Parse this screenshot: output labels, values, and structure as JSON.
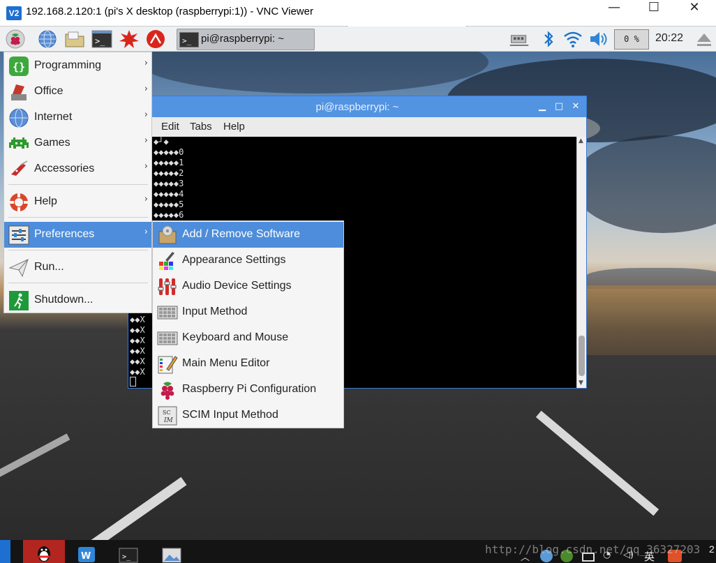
{
  "vnc_window": {
    "logo": "V2",
    "title": "192.168.2.120:1 (pi's X desktop (raspberrypi:1)) - VNC Viewer",
    "minimize": "—",
    "maximize": "☐",
    "close": "✕"
  },
  "panel": {
    "task_label": "pi@raspberrypi: ~",
    "cpu": "0 %",
    "clock": "20:22",
    "icons": [
      "raspberry-icon",
      "globe-icon",
      "folder-icon",
      "terminal-icon",
      "burst-icon",
      "wolfram-icon",
      "network-icon",
      "bluetooth-icon",
      "wifi-icon",
      "volume-icon",
      "eject-icon"
    ]
  },
  "terminal": {
    "title": "pi@raspberrypi: ~",
    "menu": [
      "Edit",
      "Tabs",
      "Help"
    ],
    "lines": [
      "◆┘◆",
      "◆◆◆◆◆0",
      "◆◆◆◆◆1",
      "◆◆◆◆◆2",
      "◆◆◆◆◆3",
      "◆◆◆◆◆4",
      "◆◆◆◆◆5",
      "◆◆◆◆◆6"
    ],
    "lower_lines": [
      "◆◆X",
      "◆◆X",
      "◆◆X",
      "◆◆X",
      "◆◆X",
      "◆◆X"
    ],
    "minimize": "▁",
    "maximize": "□",
    "close": "✕"
  },
  "main_menu": {
    "items": [
      {
        "label": "Programming",
        "arrow": "›"
      },
      {
        "label": "Office",
        "arrow": "›"
      },
      {
        "label": "Internet",
        "arrow": "›"
      },
      {
        "label": "Games",
        "arrow": "›"
      },
      {
        "label": "Accessories",
        "arrow": "›"
      },
      {
        "label": "Help",
        "arrow": "›"
      },
      {
        "label": "Preferences",
        "arrow": "›"
      },
      {
        "label": "Run..."
      },
      {
        "label": "Shutdown..."
      }
    ]
  },
  "prefs_menu": {
    "items": [
      {
        "label": "Add / Remove Software"
      },
      {
        "label": "Appearance Settings"
      },
      {
        "label": "Audio Device Settings"
      },
      {
        "label": "Input Method"
      },
      {
        "label": "Keyboard and Mouse"
      },
      {
        "label": "Main Menu Editor"
      },
      {
        "label": "Raspberry Pi Configuration"
      },
      {
        "label": "SCIM Input Method"
      }
    ]
  },
  "windows_taskbar": {
    "watermark": "http://blog.csdn.net/qq_36327203",
    "ime": "英",
    "clock_fragment": "2"
  }
}
